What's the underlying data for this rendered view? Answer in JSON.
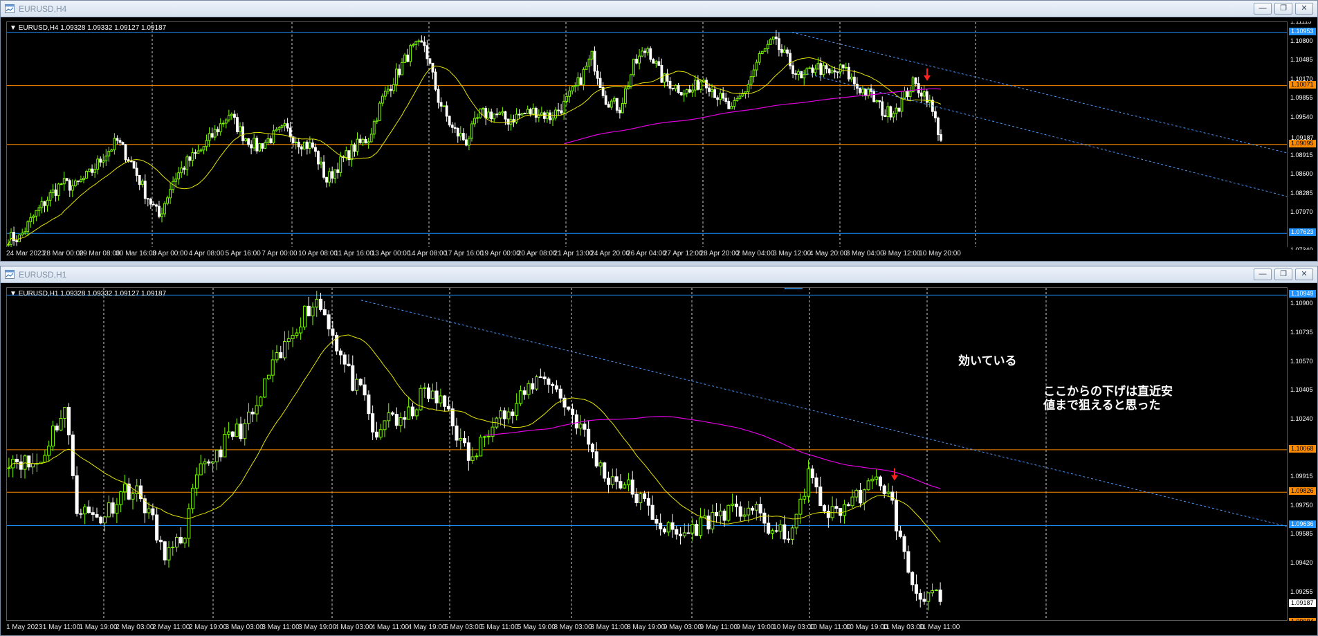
{
  "windows": [
    {
      "id": "h4",
      "title": "EURUSD,H4",
      "header": "EURUSD,H4  1.09328 1.09332 1.09127 1.09187",
      "price_ticks": [
        "1.11115",
        "1.10800",
        "1.10485",
        "1.10170",
        "1.09855",
        "1.09540",
        "1.08915",
        "1.08600",
        "1.08285",
        "1.07970",
        "1.07340"
      ],
      "price_badges": [
        {
          "text": "1.10953",
          "bg": "#1e90ff",
          "fg": "#ffffff",
          "price": 1.10953
        },
        {
          "text": "1.10071",
          "bg": "#ff8c00",
          "fg": "#000000",
          "price": 1.10071
        },
        {
          "text": "1.09187",
          "bg": "#000000",
          "fg": "#ffffff",
          "price": 1.09187
        },
        {
          "text": "1.09095",
          "bg": "#ff8c00",
          "fg": "#000000",
          "price": 1.09095
        },
        {
          "text": "1.07623",
          "bg": "#1e90ff",
          "fg": "#ffffff",
          "price": 1.07623
        }
      ],
      "time_labels": [
        "24 Mar 2023",
        "28 Mar 00:00",
        "29 Mar 08:00",
        "30 Mar 16:00",
        "3 Apr 00:00",
        "4 Apr 08:00",
        "5 Apr 16:00",
        "7 Apr 00:00",
        "10 Apr 08:00",
        "11 Apr 16:00",
        "13 Apr 00:00",
        "14 Apr 08:00",
        "17 Apr 16:00",
        "19 Apr 00:00",
        "20 Apr 08:00",
        "21 Apr 13:00",
        "24 Apr 20:00",
        "26 Apr 04:00",
        "27 Apr 12:00",
        "28 Apr 20:00",
        "2 May 04:00",
        "3 May 12:00",
        "4 May 20:00",
        "8 May 04:00",
        "9 May 12:00",
        "10 May 20:00"
      ]
    },
    {
      "id": "h1",
      "title": "EURUSD,H1",
      "header": "EURUSD,H1  1.09328 1.09332 1.09127 1.09187",
      "price_ticks": [
        "1.10900",
        "1.10735",
        "1.10570",
        "1.10405",
        "1.10240",
        "1.09915",
        "1.09750",
        "1.09585",
        "1.09420",
        "1.09255"
      ],
      "price_badges": [
        {
          "text": "1.10949",
          "bg": "#1e90ff",
          "fg": "#ffffff",
          "price": 1.10949
        },
        {
          "text": "1.10068",
          "bg": "#ff8c00",
          "fg": "#000000",
          "price": 1.10068
        },
        {
          "text": "1.09826",
          "bg": "#ff8c00",
          "fg": "#000000",
          "price": 1.09826
        },
        {
          "text": "1.09636",
          "bg": "#1e90ff",
          "fg": "#ffffff",
          "price": 1.09636
        },
        {
          "text": "1.09187",
          "bg": "#ffffff",
          "fg": "#000000",
          "price": 1.09187
        },
        {
          "text": "1.09084",
          "bg": "#ff8c00",
          "fg": "#000000",
          "price": 1.09084
        }
      ],
      "time_labels": [
        "1 May 2023",
        "1 May 11:00",
        "1 May 19:00",
        "2 May 03:00",
        "2 May 11:00",
        "2 May 19:00",
        "3 May 03:00",
        "3 May 11:00",
        "3 May 19:00",
        "4 May 03:00",
        "4 May 11:00",
        "4 May 19:00",
        "5 May 03:00",
        "5 May 11:00",
        "5 May 19:00",
        "8 May 03:00",
        "8 May 11:00",
        "8 May 19:00",
        "9 May 03:00",
        "9 May 11:00",
        "9 May 19:00",
        "10 May 03:00",
        "10 May 11:00",
        "10 May 19:00",
        "11 May 03:00",
        "11 May 11:00"
      ],
      "annotations": {
        "working": "効いている",
        "target": "ここからの下げは直近安\n値まで狙えると思った"
      }
    }
  ],
  "colors": {
    "bull": "#7cfc00",
    "bear": "#ffffff",
    "ma_fast": "#e6e600",
    "ma_slow": "#e000e0",
    "grid": "#cfcfcf",
    "trend": "#4a9bff",
    "arrow": "#ff2020"
  },
  "icons": {
    "window": "chart-window-icon",
    "minimize": "minimize-icon",
    "restore": "restore-icon",
    "close": "close-icon"
  },
  "chart_data": [
    {
      "type": "candlestick",
      "title": "EURUSD,H4",
      "symbol": "EURUSD",
      "timeframe": "H4",
      "ohlc_last": {
        "open": 1.09328,
        "high": 1.09332,
        "low": 1.09127,
        "close": 1.09187
      },
      "ylim": [
        1.0734,
        1.1112
      ],
      "x_range": [
        "24 Mar 2023",
        "10 May 20:00"
      ],
      "horizontal_lines": [
        1.10953,
        1.10071,
        1.09095,
        1.07623
      ],
      "indicators": [
        "moving average (yellow)",
        "moving average (magenta)"
      ],
      "close_path": [
        1.0755,
        1.079,
        1.082,
        1.0845,
        1.084,
        1.086,
        1.089,
        1.0915,
        1.088,
        1.083,
        1.079,
        1.085,
        1.088,
        1.09,
        1.093,
        1.096,
        1.0925,
        1.0905,
        1.092,
        1.0935,
        1.0915,
        1.0905,
        1.085,
        1.088,
        1.0905,
        1.092,
        1.0985,
        1.1025,
        1.1065,
        1.1075,
        1.0985,
        1.0935,
        1.0915,
        1.096,
        1.096,
        1.095,
        1.096,
        1.0965,
        1.0955,
        1.0975,
        1.101,
        1.1055,
        1.0985,
        1.097,
        1.104,
        1.107,
        1.102,
        1.1005,
        1.0995,
        1.102,
        1.099,
        1.0965,
        1.1,
        1.1055,
        1.108,
        1.105,
        1.1015,
        1.104,
        1.1025,
        1.1035,
        1.1005,
        1.099,
        1.096,
        1.0975,
        1.101,
        1.099,
        1.092
      ],
      "trend_channel": true
    },
    {
      "type": "candlestick",
      "title": "EURUSD,H1",
      "symbol": "EURUSD",
      "timeframe": "H1",
      "ohlc_last": {
        "open": 1.09328,
        "high": 1.09332,
        "low": 1.09127,
        "close": 1.09187
      },
      "ylim": [
        1.0909,
        1.1099
      ],
      "x_range": [
        "1 May 2023",
        "11 May 11:00"
      ],
      "horizontal_lines": [
        1.10949,
        1.10068,
        1.09826,
        1.09636,
        1.09084
      ],
      "indicators": [
        "moving average (yellow)",
        "moving average (magenta)"
      ],
      "close_path": [
        1.1002,
        1.0998,
        1.1,
        1.1018,
        1.103,
        1.0975,
        1.097,
        1.0968,
        1.0976,
        1.0985,
        1.0982,
        1.0972,
        1.095,
        1.0948,
        1.096,
        1.099,
        1.1,
        1.1008,
        1.1016,
        1.102,
        1.103,
        1.105,
        1.106,
        1.1075,
        1.1085,
        1.1092,
        1.108,
        1.106,
        1.1045,
        1.1035,
        1.101,
        1.103,
        1.102,
        1.103,
        1.104,
        1.1035,
        1.103,
        1.101,
        1.1,
        1.1015,
        1.103,
        1.1025,
        1.1035,
        1.1045,
        1.105,
        1.104,
        1.103,
        1.102,
        1.1005,
        1.0992,
        1.099,
        1.0985,
        1.0978,
        1.097,
        1.0962,
        1.0958,
        1.096,
        1.0965,
        1.0968,
        1.0972,
        1.097,
        1.0975,
        1.0968,
        1.096,
        1.0958,
        1.0965,
        1.0995,
        1.0975,
        1.097,
        1.0975,
        1.098,
        1.0985,
        1.099,
        1.0975,
        1.0945,
        1.0925,
        1.0925,
        1.092
      ]
    }
  ]
}
